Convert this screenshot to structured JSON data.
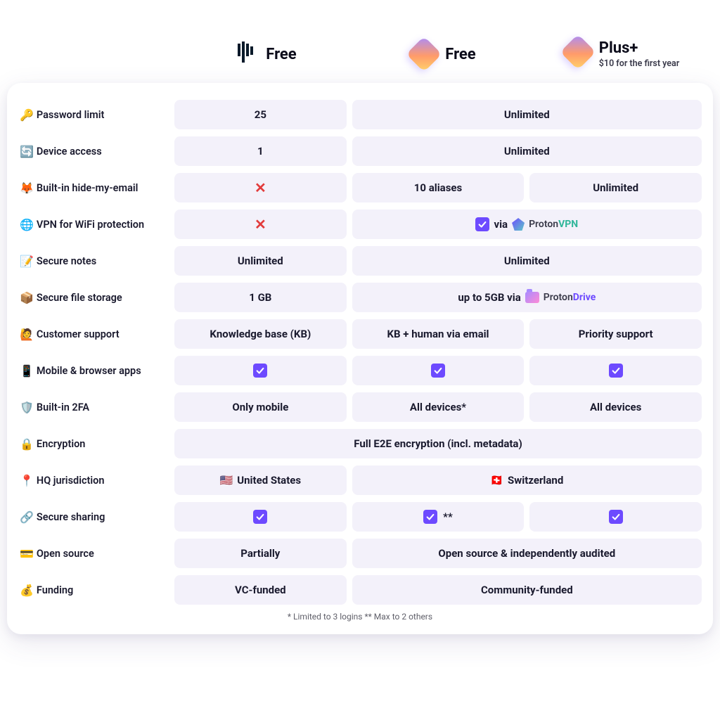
{
  "plans": {
    "a": {
      "name": "Free"
    },
    "b": {
      "name": "Free"
    },
    "c": {
      "name": "Plus+",
      "subtitle": "$10 for the first year"
    }
  },
  "rows": {
    "password_limit": {
      "emoji": "🔑",
      "label": "Password limit",
      "a": "25",
      "bc": "Unlimited"
    },
    "device_access": {
      "emoji": "🔄",
      "label": "Device access",
      "a": "1",
      "bc": "Unlimited"
    },
    "hide_email": {
      "emoji": "🦊",
      "label": "Built-in hide-my-email",
      "b": "10 aliases",
      "c": "Unlimited"
    },
    "vpn": {
      "emoji": "🌐",
      "label": "VPN for WiFi protection",
      "via": "via"
    },
    "secure_notes": {
      "emoji": "📝",
      "label": "Secure notes",
      "a": "Unlimited",
      "bc": "Unlimited"
    },
    "file_storage": {
      "emoji": "📦",
      "label": "Secure file storage",
      "a": "1 GB",
      "bc_prefix": "up to 5GB via"
    },
    "support": {
      "emoji": "🙋",
      "label": "Customer support",
      "a": "Knowledge base (KB)",
      "b": "KB + human via email",
      "c": "Priority support"
    },
    "apps": {
      "emoji": "📱",
      "label": "Mobile & browser apps"
    },
    "twofa": {
      "emoji": "🛡️",
      "label": "Built-in 2FA",
      "a": "Only mobile",
      "b": "All devices*",
      "c": "All devices"
    },
    "encryption": {
      "emoji": "🔒",
      "label": "Encryption",
      "all": "Full E2E encryption (incl. metadata)"
    },
    "hq": {
      "emoji": "📍",
      "label": "HQ  jurisdiction",
      "a_flag": "🇺🇸",
      "a": "United States",
      "bc_flag": "🇨🇭",
      "bc": "Switzerland"
    },
    "sharing": {
      "emoji": "🔗",
      "label": "Secure sharing",
      "b_note": "**"
    },
    "opensource": {
      "emoji": "💳",
      "label": "Open source",
      "a": "Partially",
      "bc": "Open source & independently audited"
    },
    "funding": {
      "emoji": "💰",
      "label": "Funding",
      "a": "VC-funded",
      "bc": "Community-funded"
    }
  },
  "proton_vpn": {
    "p1": "Proton",
    "p2": "VPN"
  },
  "proton_drive": {
    "p1": "Proton",
    "p2": "Drive"
  },
  "footnote": "* Limited to 3 logins   ** Max to 2 others"
}
